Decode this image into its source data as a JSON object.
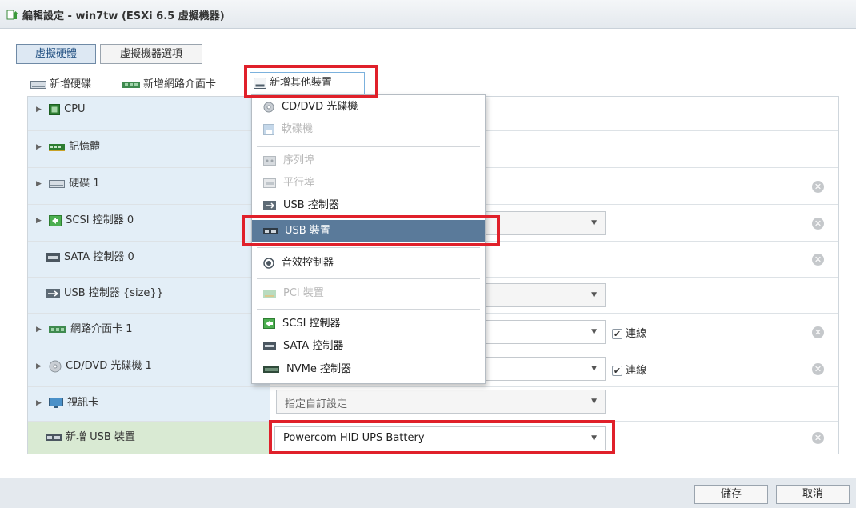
{
  "window": {
    "title": "編輯設定 - win7tw (ESXi 6.5 虛擬機器)"
  },
  "tabs": [
    {
      "label": "虛擬硬體",
      "active": true
    },
    {
      "label": "虛擬機器選項",
      "active": false
    }
  ],
  "toolbar": {
    "add_disk": "新增硬碟",
    "add_nic": "新增網路介面卡",
    "add_other": "新增其他裝置"
  },
  "rows": [
    {
      "label": "CPU",
      "expandable": true
    },
    {
      "label": "記憶體",
      "expandable": true
    },
    {
      "label": "硬碟 1",
      "expandable": true
    },
    {
      "label": "SCSI 控制器 0",
      "expandable": true
    },
    {
      "label": "SATA 控制器 0",
      "expandable": false
    },
    {
      "label": "USB 控制器 {size}}",
      "expandable": false
    },
    {
      "label": "網路介面卡 1",
      "expandable": true,
      "checkbox_label": "連線",
      "checked": true
    },
    {
      "label": "CD/DVD 光碟機 1",
      "expandable": true,
      "checkbox_label": "連線",
      "checked": true
    },
    {
      "label": "視訊卡",
      "expandable": true,
      "select_value": "指定自訂設定"
    },
    {
      "label": "新增 USB 裝置",
      "expandable": false,
      "select_value": "Powercom HID UPS Battery"
    }
  ],
  "dropdown": {
    "items": [
      {
        "label": "CD/DVD 光碟機",
        "disabled": false,
        "selected": false,
        "icon": "disc-icon"
      },
      {
        "label": "軟碟機",
        "disabled": true,
        "selected": false,
        "icon": "floppy-icon"
      },
      {
        "label": "序列埠",
        "disabled": true,
        "selected": false,
        "icon": "serial-port-icon"
      },
      {
        "label": "平行埠",
        "disabled": true,
        "selected": false,
        "icon": "parallel-port-icon"
      },
      {
        "label": "USB 控制器",
        "disabled": false,
        "selected": false,
        "icon": "usb-controller-icon"
      },
      {
        "label": "USB 裝置",
        "disabled": false,
        "selected": true,
        "icon": "usb-device-icon"
      },
      {
        "label": "音效控制器",
        "disabled": false,
        "selected": false,
        "icon": "sound-icon"
      },
      {
        "label": "PCI 裝置",
        "disabled": true,
        "selected": false,
        "icon": "pci-icon"
      },
      {
        "label": "SCSI 控制器",
        "disabled": false,
        "selected": false,
        "icon": "scsi-icon"
      },
      {
        "label": "SATA 控制器",
        "disabled": false,
        "selected": false,
        "icon": "sata-icon"
      },
      {
        "label": "NVMe 控制器",
        "disabled": false,
        "selected": false,
        "icon": "nvme-icon"
      }
    ]
  },
  "footer": {
    "save_label": "儲存",
    "cancel_label": "取消"
  },
  "colors": {
    "highlight": "#e0202a",
    "selected_item": "#5a7a9a",
    "label_column": "#e3eef7",
    "new_row": "#d9ead3"
  }
}
